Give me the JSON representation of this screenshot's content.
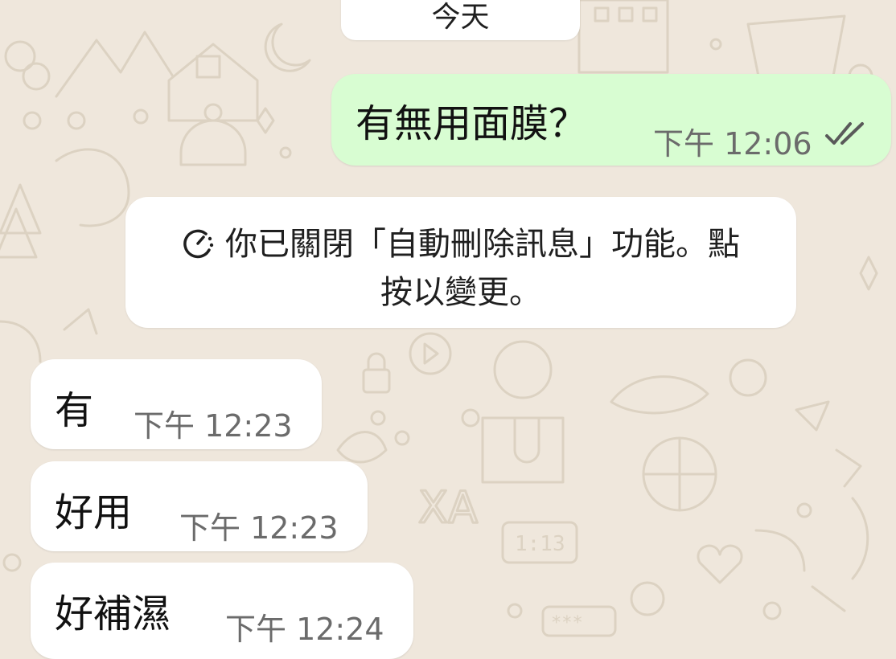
{
  "date_chip": {
    "label": "今天"
  },
  "system_notice": {
    "icon": "timer-icon",
    "line1": "你已關閉「自動刪除訊息」功能。點",
    "line2": "按以變更。"
  },
  "messages": [
    {
      "direction": "outgoing",
      "text": "有無用面膜？",
      "time": "下午 12:06",
      "status_icon": "double-check-icon"
    },
    {
      "direction": "incoming",
      "text": "有",
      "time": "下午 12:23"
    },
    {
      "direction": "incoming",
      "text": "好用",
      "time": "下午 12:23"
    },
    {
      "direction": "incoming",
      "text": "好補濕",
      "time": "下午 12:24"
    }
  ],
  "colors": {
    "wallpaper": "#efe7dc",
    "outgoing_bubble": "#d8fdd2",
    "incoming_bubble": "#ffffff",
    "timestamp": "#6b6b6b",
    "read_ticks": "#5a5a5a"
  }
}
